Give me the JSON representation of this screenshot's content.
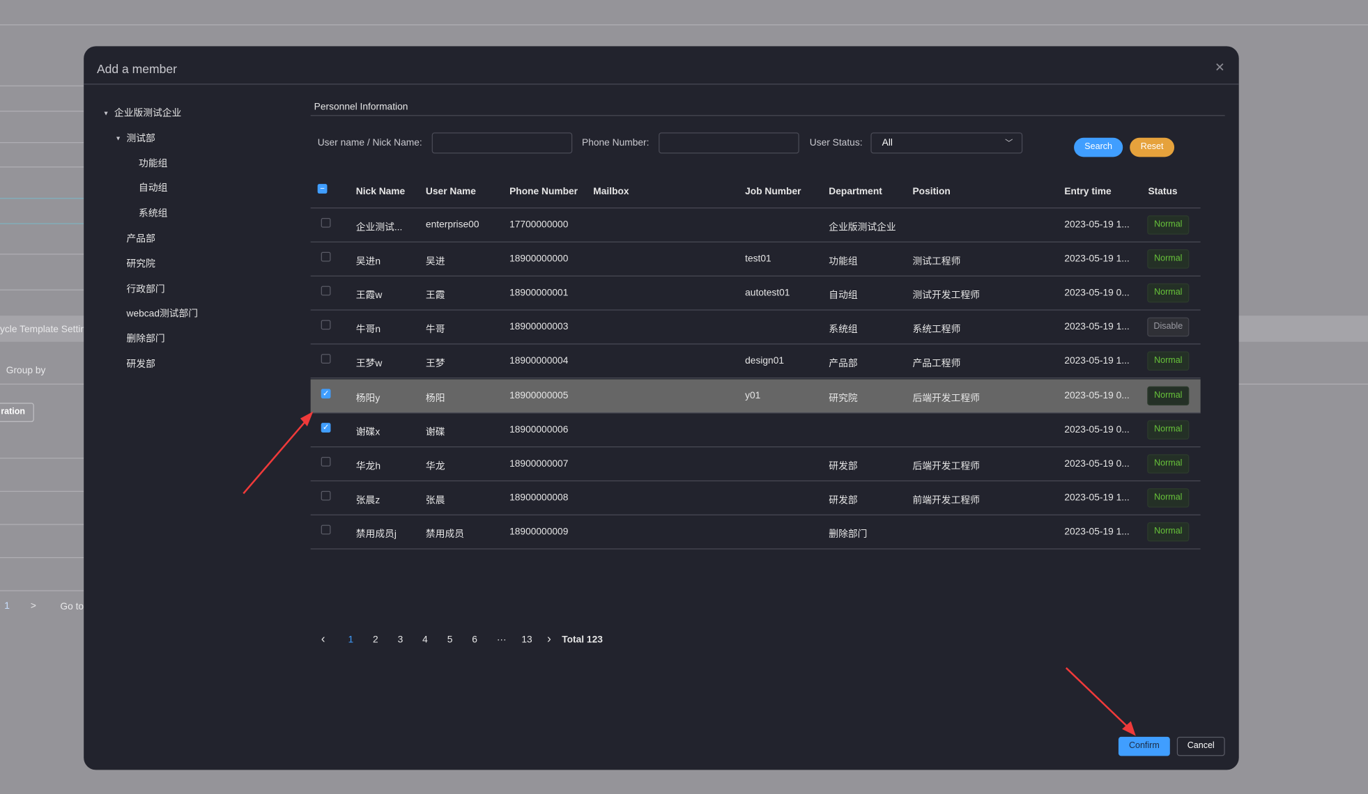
{
  "background": {
    "tab_label": "ycle Template Settin",
    "group_by": "Group by",
    "button": "ration",
    "page": "1",
    "next": ">",
    "goto": "Go to"
  },
  "modal": {
    "title": "Add a member",
    "close_icon": "close-icon"
  },
  "tree": [
    {
      "label": "企业版测试企业",
      "level": 0,
      "expanded": true
    },
    {
      "label": "测试部",
      "level": 1,
      "expanded": true
    },
    {
      "label": "功能组",
      "level": 2
    },
    {
      "label": "自动组",
      "level": 2
    },
    {
      "label": "系统组",
      "level": 2
    },
    {
      "label": "产品部",
      "level": 1
    },
    {
      "label": "研究院",
      "level": 1
    },
    {
      "label": "行政部门",
      "level": 1
    },
    {
      "label": "webcad测试部门",
      "level": 1
    },
    {
      "label": "删除部门",
      "level": 1
    },
    {
      "label": "研发部",
      "level": 1
    }
  ],
  "section_title": "Personnel Information",
  "filters": {
    "username_label": "User name / Nick Name:",
    "username_value": "",
    "phone_label": "Phone Number:",
    "phone_value": "",
    "status_label": "User Status:",
    "status_value": "All",
    "search": "Search",
    "reset": "Reset"
  },
  "colors": {
    "primary": "#409eff",
    "warning": "#e6a23c",
    "success": "#67c23a"
  },
  "table": {
    "headers": [
      "Nick Name",
      "User Name",
      "Phone Number",
      "Mailbox",
      "Job Number",
      "Department",
      "Position",
      "Entry time",
      "Status"
    ],
    "rows": [
      {
        "checked": false,
        "nick": "企业测试...",
        "user": "enterprise00",
        "phone": "17700000000",
        "mail": "",
        "job": "",
        "dept": "企业版测试企业",
        "pos": "",
        "entry": "2023-05-19 1...",
        "status": "Normal"
      },
      {
        "checked": false,
        "nick": "吴进n",
        "user": "吴进",
        "phone": "18900000000",
        "mail": "",
        "job": "test01",
        "dept": "功能组",
        "pos": "测试工程师",
        "entry": "2023-05-19 1...",
        "status": "Normal"
      },
      {
        "checked": false,
        "nick": "王霞w",
        "user": "王霞",
        "phone": "18900000001",
        "mail": "",
        "job": "autotest01",
        "dept": "自动组",
        "pos": "测试开发工程师",
        "entry": "2023-05-19 0...",
        "status": "Normal"
      },
      {
        "checked": false,
        "nick": "牛哥n",
        "user": "牛哥",
        "phone": "18900000003",
        "mail": "",
        "job": "",
        "dept": "系统组",
        "pos": "系统工程师",
        "entry": "2023-05-19 1...",
        "status": "Disable"
      },
      {
        "checked": false,
        "nick": "王梦w",
        "user": "王梦",
        "phone": "18900000004",
        "mail": "",
        "job": "design01",
        "dept": "产品部",
        "pos": "产品工程师",
        "entry": "2023-05-19 1...",
        "status": "Normal"
      },
      {
        "checked": true,
        "nick": "杨阳y",
        "user": "杨阳",
        "phone": "18900000005",
        "mail": "",
        "job": "y01",
        "dept": "研究院",
        "pos": "后端开发工程师",
        "entry": "2023-05-19 0...",
        "status": "Normal",
        "hover": true
      },
      {
        "checked": true,
        "nick": "谢碟x",
        "user": "谢碟",
        "phone": "18900000006",
        "mail": "",
        "job": "",
        "dept": "",
        "pos": "",
        "entry": "2023-05-19 0...",
        "status": "Normal"
      },
      {
        "checked": false,
        "nick": "华龙h",
        "user": "华龙",
        "phone": "18900000007",
        "mail": "",
        "job": "",
        "dept": "研发部",
        "pos": "后端开发工程师",
        "entry": "2023-05-19 0...",
        "status": "Normal"
      },
      {
        "checked": false,
        "nick": "张晨z",
        "user": "张晨",
        "phone": "18900000008",
        "mail": "",
        "job": "",
        "dept": "研发部",
        "pos": "前端开发工程师",
        "entry": "2023-05-19 1...",
        "status": "Normal"
      },
      {
        "checked": false,
        "nick": "禁用成员j",
        "user": "禁用成员",
        "phone": "18900000009",
        "mail": "",
        "job": "",
        "dept": "删除部门",
        "pos": "",
        "entry": "2023-05-19 1...",
        "status": "Normal"
      }
    ]
  },
  "pagination": {
    "prev": "‹",
    "pages": [
      "1",
      "2",
      "3",
      "4",
      "5",
      "6",
      "···",
      "13"
    ],
    "current": "1",
    "next": "›",
    "total": "Total 123"
  },
  "footer": {
    "confirm": "Confirm",
    "cancel": "Cancel"
  }
}
